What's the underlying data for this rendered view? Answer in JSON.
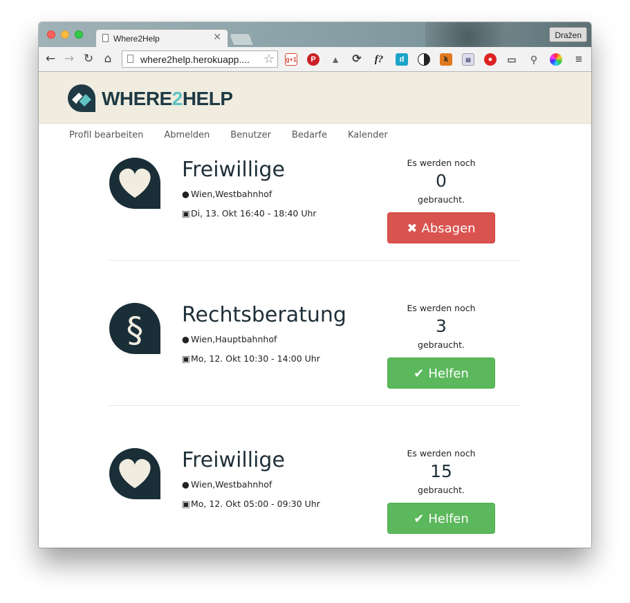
{
  "browser": {
    "tab_title": "Where2Help",
    "url": "where2help.herokuapp....",
    "profile_name": "Dražen"
  },
  "logo": {
    "part1": "WHERE",
    "part2": "2",
    "part3": "HELP"
  },
  "nav": [
    {
      "label": "Profil bearbeiten"
    },
    {
      "label": "Abmelden"
    },
    {
      "label": "Benutzer"
    },
    {
      "label": "Bedarfe"
    },
    {
      "label": "Kalender"
    }
  ],
  "needs_prefix": "Es werden noch",
  "needs_suffix": "gebraucht.",
  "cards": [
    {
      "icon": "heart-icon",
      "title": "Freiwillige",
      "location": "Wien,Westbahnhof",
      "date": "Di, 13. Okt 16:40 - 18:40 Uhr",
      "needed": "0",
      "button": "Absagen",
      "button_style": "danger"
    },
    {
      "icon": "paragraph-icon",
      "title": "Rechtsberatung",
      "location": "Wien,Hauptbahnhof",
      "date": "Mo, 12. Okt 10:30 - 14:00 Uhr",
      "needed": "3",
      "button": "Helfen",
      "button_style": "success"
    },
    {
      "icon": "heart-icon",
      "title": "Freiwillige",
      "location": "Wien,Westbahnhof",
      "date": "Mo, 12. Okt 05:00 - 09:30 Uhr",
      "needed": "15",
      "button": "Helfen",
      "button_style": "success"
    }
  ],
  "colors": {
    "danger": "#d9534f",
    "success": "#5cb85c",
    "brand_dark": "#1e3a44",
    "brand_accent": "#5fc3c2",
    "header_bg": "#f0ede0"
  }
}
